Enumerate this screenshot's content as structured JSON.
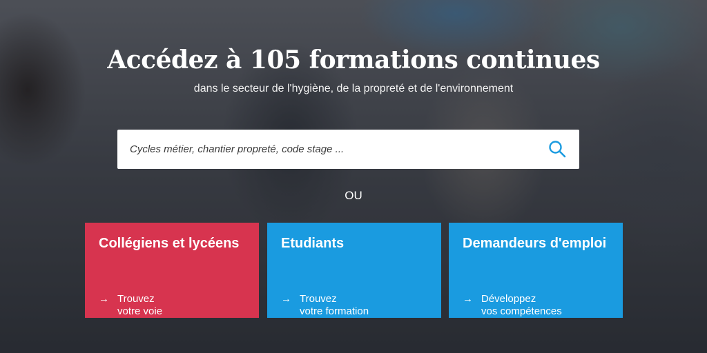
{
  "hero": {
    "title": "Accédez à 105 formations continues",
    "subtitle": "dans le secteur de l'hygiène, de la propreté et de l'environnement"
  },
  "search": {
    "placeholder": "Cycles métier, chantier propreté, code stage ..."
  },
  "separator": "OU",
  "cards": [
    {
      "title": "Collégiens et lycéens",
      "link_line1": "Trouvez",
      "link_line2": "votre voie",
      "color": "#d7344f"
    },
    {
      "title": "Etudiants",
      "link_line1": "Trouvez",
      "link_line2": "votre formation",
      "color": "#1a9be0"
    },
    {
      "title": "Demandeurs d'emploi",
      "link_line1": "Développez",
      "link_line2": "vos compétences",
      "color": "#1a9be0"
    }
  ],
  "icons": {
    "search": "search-icon",
    "arrow": "arrow-right-icon"
  },
  "colors": {
    "accent_blue": "#1a9be0",
    "accent_red": "#d7344f",
    "search_icon": "#1a9be0"
  }
}
